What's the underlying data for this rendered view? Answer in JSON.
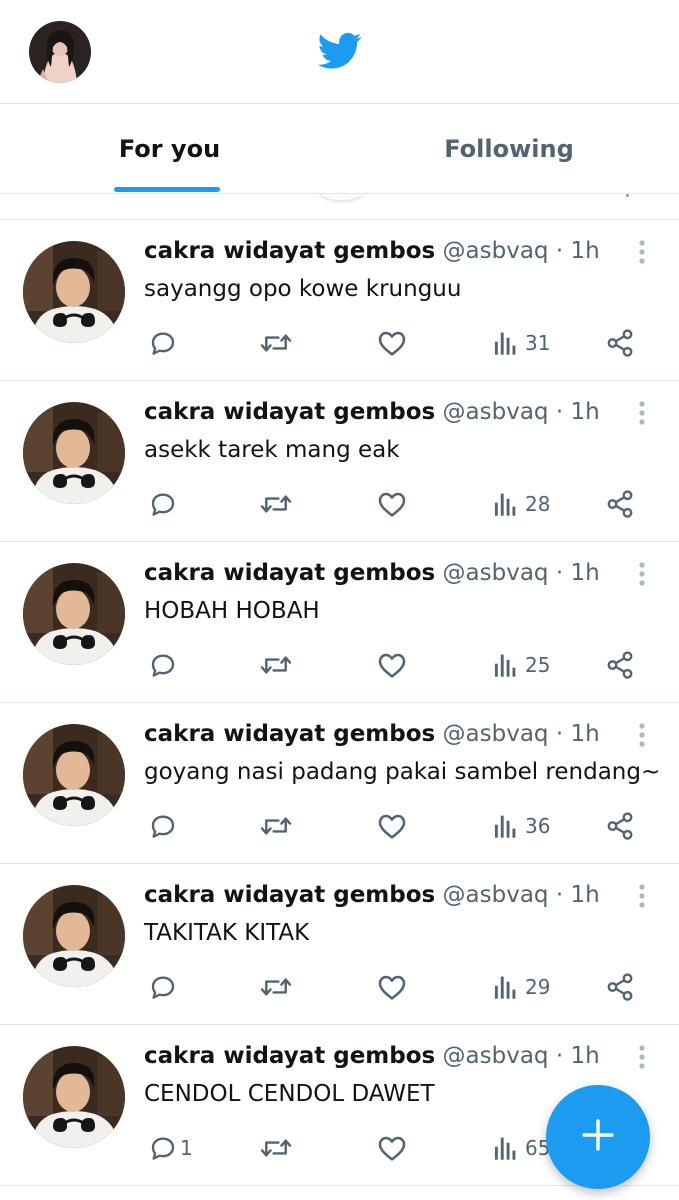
{
  "header": {
    "avatar_icon": "profile-avatar",
    "logo_icon": "twitter-bird-icon",
    "brand_color": "#1d9bf0"
  },
  "tabs": [
    {
      "label": "For you",
      "active": true
    },
    {
      "label": "Following",
      "active": false
    }
  ],
  "tweets": [
    {
      "name": "cakra widayat gembos",
      "handle": "@asbvaq",
      "time": "1h",
      "text": "sayangg opo kowe krunguu",
      "reply_count": "",
      "views": "31"
    },
    {
      "name": "cakra widayat gembos",
      "handle": "@asbvaq",
      "time": "1h",
      "text": "asekk tarek mang eak",
      "reply_count": "",
      "views": "28"
    },
    {
      "name": "cakra widayat gembos",
      "handle": "@asbvaq",
      "time": "1h",
      "text": "HOBAH HOBAH",
      "reply_count": "",
      "views": "25"
    },
    {
      "name": "cakra widayat gembos",
      "handle": "@asbvaq",
      "time": "1h",
      "text": "goyang nasi padang pakai sambel rendang~",
      "reply_count": "",
      "views": "36"
    },
    {
      "name": "cakra widayat gembos",
      "handle": "@asbvaq",
      "time": "1h",
      "text": "TAKITAK KITAK",
      "reply_count": "",
      "views": "29"
    },
    {
      "name": "cakra widayat gembos",
      "handle": "@asbvaq",
      "time": "1h",
      "text": "CENDOL CENDOL DAWET",
      "reply_count": "1",
      "views": "65"
    }
  ],
  "actions": {
    "reply_icon": "reply-icon",
    "retweet_icon": "retweet-icon",
    "like_icon": "heart-icon",
    "views_icon": "views-icon",
    "share_icon": "share-icon"
  },
  "fab": {
    "icon": "plus-icon"
  }
}
